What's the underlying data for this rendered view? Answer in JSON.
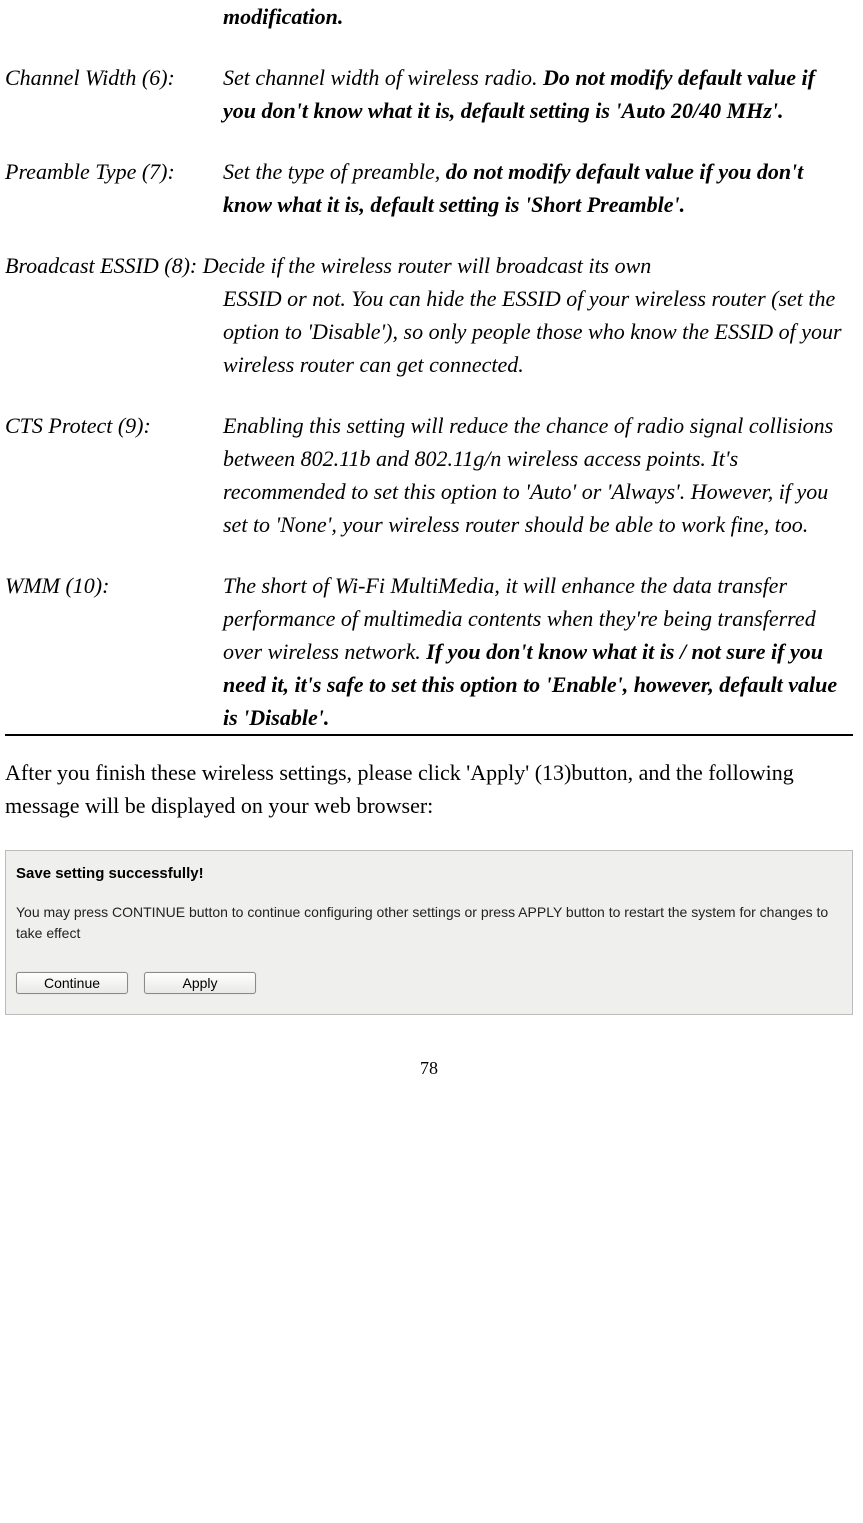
{
  "topFragment": "modification.",
  "rows": [
    {
      "term": "Channel Width (6):",
      "partA": "Set channel width of wireless radio. ",
      "bold": "Do not modify default value if you don't know what it is, default setting is 'Auto 20/40 MHz'.",
      "partB": ""
    },
    {
      "term": "Preamble Type (7):",
      "partA": "Set the type of preamble, ",
      "bold": "do not modify default value if you don't know what it is, default setting is 'Short Preamble'.",
      "partB": ""
    },
    {
      "term": "Broadcast ESSID (8):",
      "partA": "Decide if the wireless router will broadcast its own ESSID or not. You can hide the ESSID of your wireless router (set the option to 'Disable'), so only people those who know the ESSID of your wireless router can get connected.",
      "bold": "",
      "partB": ""
    },
    {
      "term": "CTS Protect (9):",
      "partA": "Enabling this setting will reduce the chance of radio signal collisions between 802.11b and 802.11g/n wireless access points. It's recommended to set this option to 'Auto' or 'Always'. However, if you set to 'None', your wireless router should be able to work fine, too.",
      "bold": "",
      "partB": ""
    },
    {
      "term": "WMM (10):",
      "partA": "The short of Wi-Fi MultiMedia, it will enhance the data transfer performance of multimedia contents when they're being transferred over wireless network. ",
      "bold": "If you don't know what it is / not sure if you need it, it's safe to set this option to 'Enable', however, default value is 'Disable'.",
      "partB": ""
    }
  ],
  "bodyText": "After you finish these wireless settings, please click 'Apply' (13)button, and the following message will be displayed on your web browser:",
  "dialog": {
    "title": "Save setting successfully!",
    "text": "You may press CONTINUE button to continue configuring other settings or press APPLY button to restart the system for changes to take effect",
    "continueLabel": "Continue",
    "applyLabel": "Apply"
  },
  "pageNumber": "78"
}
